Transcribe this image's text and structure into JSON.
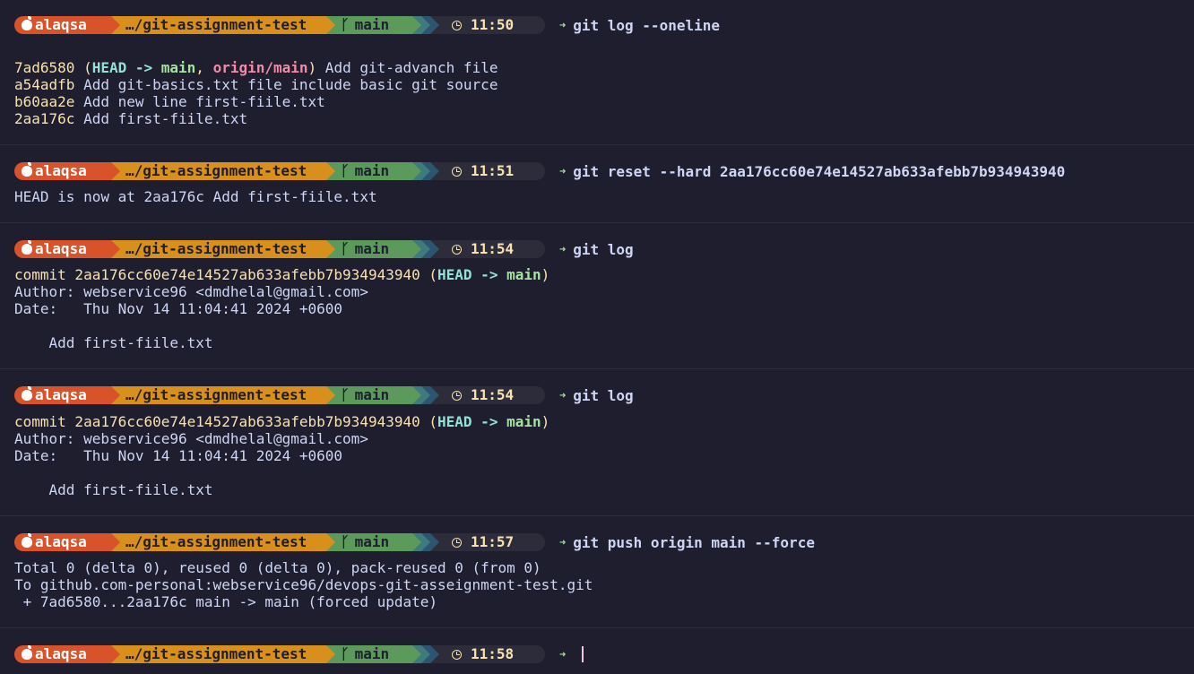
{
  "prompt": {
    "user": "alaqsa",
    "path": "…/git-assignment-test",
    "branch": "main"
  },
  "blocks": [
    {
      "time": "11:50",
      "command": "git log --oneline",
      "oneline": [
        {
          "hash": "7ad6580",
          "paren_open": " (",
          "head": "HEAD",
          "arrow": " -> ",
          "branch": "main",
          "comma": ", ",
          "remote": "origin/main",
          "paren_close": ")",
          "msg": " Add git-advanch file"
        },
        {
          "hash": "a54adfb",
          "msg": " Add git-basics.txt file include basic git source"
        },
        {
          "hash": "b60aa2e",
          "msg": " Add new line first-fiile.txt"
        },
        {
          "hash": "2aa176c",
          "msg": " Add first-fiile.txt"
        }
      ]
    },
    {
      "time": "11:51",
      "command": "git reset --hard 2aa176cc60e74e14527ab633afebb7b934943940",
      "output": [
        "HEAD is now at 2aa176c Add first-fiile.txt"
      ]
    },
    {
      "time": "11:54",
      "command": "git log",
      "commit_label": "commit 2aa176cc60e74e14527ab633afebb7b934943940",
      "paren_open": " (",
      "head": "HEAD",
      "arrow": " -> ",
      "branch": "main",
      "paren_close": ")",
      "author": "Author: webservice96 <dmdhelal@gmail.com>",
      "date": "Date:   Thu Nov 14 11:04:41 2024 +0600",
      "message": "    Add first-fiile.txt"
    },
    {
      "time": "11:54",
      "command": "git log",
      "commit_label": "commit 2aa176cc60e74e14527ab633afebb7b934943940",
      "paren_open": " (",
      "head": "HEAD",
      "arrow": " -> ",
      "branch": "main",
      "paren_close": ")",
      "author": "Author: webservice96 <dmdhelal@gmail.com>",
      "date": "Date:   Thu Nov 14 11:04:41 2024 +0600",
      "message": "    Add first-fiile.txt"
    },
    {
      "time": "11:57",
      "command": "git push origin main --force",
      "output": [
        "Total 0 (delta 0), reused 0 (delta 0), pack-reused 0 (from 0)",
        "To github.com-personal:webservice96/devops-git-asseignment-test.git",
        " + 7ad6580...2aa176c main -> main (forced update)"
      ]
    },
    {
      "time": "11:58",
      "command": ""
    }
  ],
  "icons": {
    "user": "apple-icon",
    "branch": "git-branch-icon",
    "time": "clock-icon",
    "prompt": "arrow-right-icon"
  },
  "colors": {
    "background": "#1e1e2e",
    "user_segment": "#d8532a",
    "path_segment": "#d98f1c",
    "branch_segment": "#5c9a5c",
    "time_segment": "#2c2c3a",
    "hash": "#f9e2af",
    "head": "#94e2d5",
    "branch": "#a6e3a1",
    "remote": "#f38ba8"
  }
}
